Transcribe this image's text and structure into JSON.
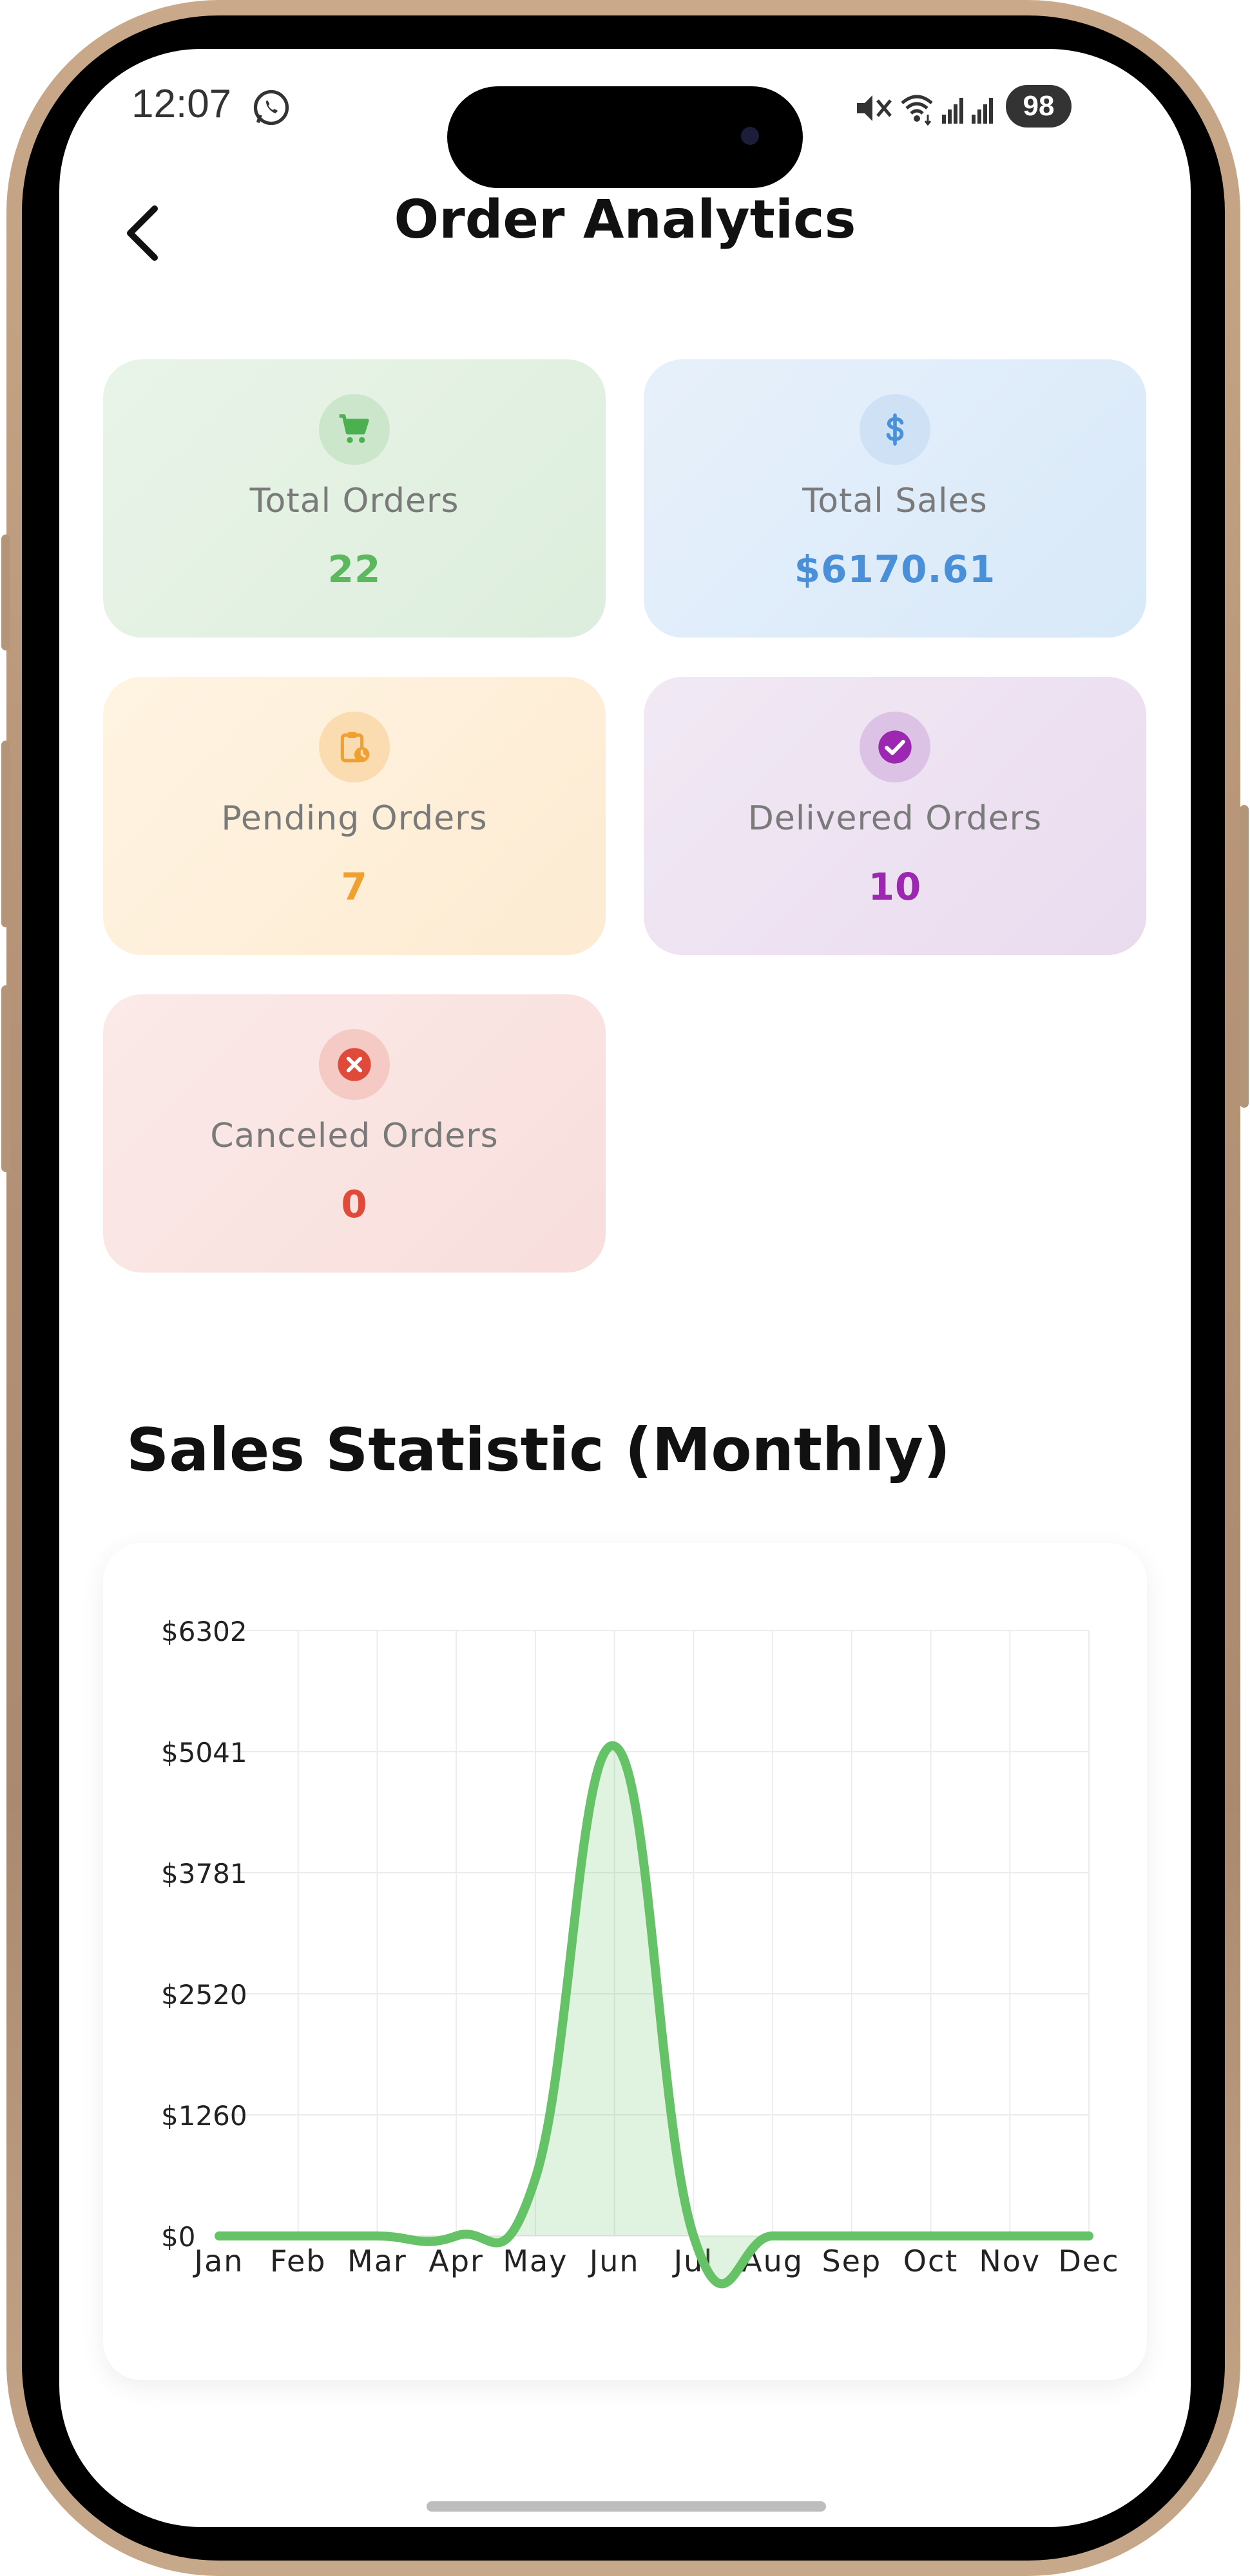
{
  "status_bar": {
    "time": "12:07",
    "battery": "98",
    "icons": [
      "whatsapp-icon",
      "mute-icon",
      "wifi-icon",
      "signal-icon",
      "signal-icon"
    ]
  },
  "header": {
    "title": "Order Analytics",
    "back_icon": "chevron-left-icon"
  },
  "stats": [
    {
      "label": "Total Orders",
      "value": "22",
      "icon": "cart-icon",
      "color": "#5cb85c",
      "circle": "#cce6cc"
    },
    {
      "label": "Total Sales",
      "value": "$6170.61",
      "icon": "dollar-icon",
      "color": "#4a90d9",
      "circle": "#cfe1f5"
    },
    {
      "label": "Pending Orders",
      "value": "7",
      "icon": "clipboard-clock-icon",
      "color": "#f0a030",
      "circle": "#fbdcb0"
    },
    {
      "label": "Delivered Orders",
      "value": "10",
      "icon": "check-circle-icon",
      "color": "#9c27b0",
      "circle": "#dcc3e5"
    },
    {
      "label": "Canceled Orders",
      "value": "0",
      "icon": "close-circle-icon",
      "color": "#e04a3a",
      "circle": "#f5c9c4"
    }
  ],
  "section_title": "Sales Statistic (Monthly)",
  "chart_data": {
    "type": "area",
    "title": "Sales Statistic (Monthly)",
    "categories": [
      "Jan",
      "Feb",
      "Mar",
      "Apr",
      "May",
      "Jun",
      "Jul",
      "Aug",
      "Sep",
      "Oct",
      "Nov",
      "Dec"
    ],
    "y_ticks": [
      "$0",
      "$1260",
      "$2520",
      "$3781",
      "$5041",
      "$6302"
    ],
    "ylim": [
      0,
      6302
    ],
    "series": [
      {
        "values": [
          0,
          0,
          0,
          0,
          600,
          5100,
          0,
          0,
          0,
          0,
          0,
          0
        ],
        "color": "#66c266"
      }
    ],
    "grid": true,
    "smooth": true
  }
}
